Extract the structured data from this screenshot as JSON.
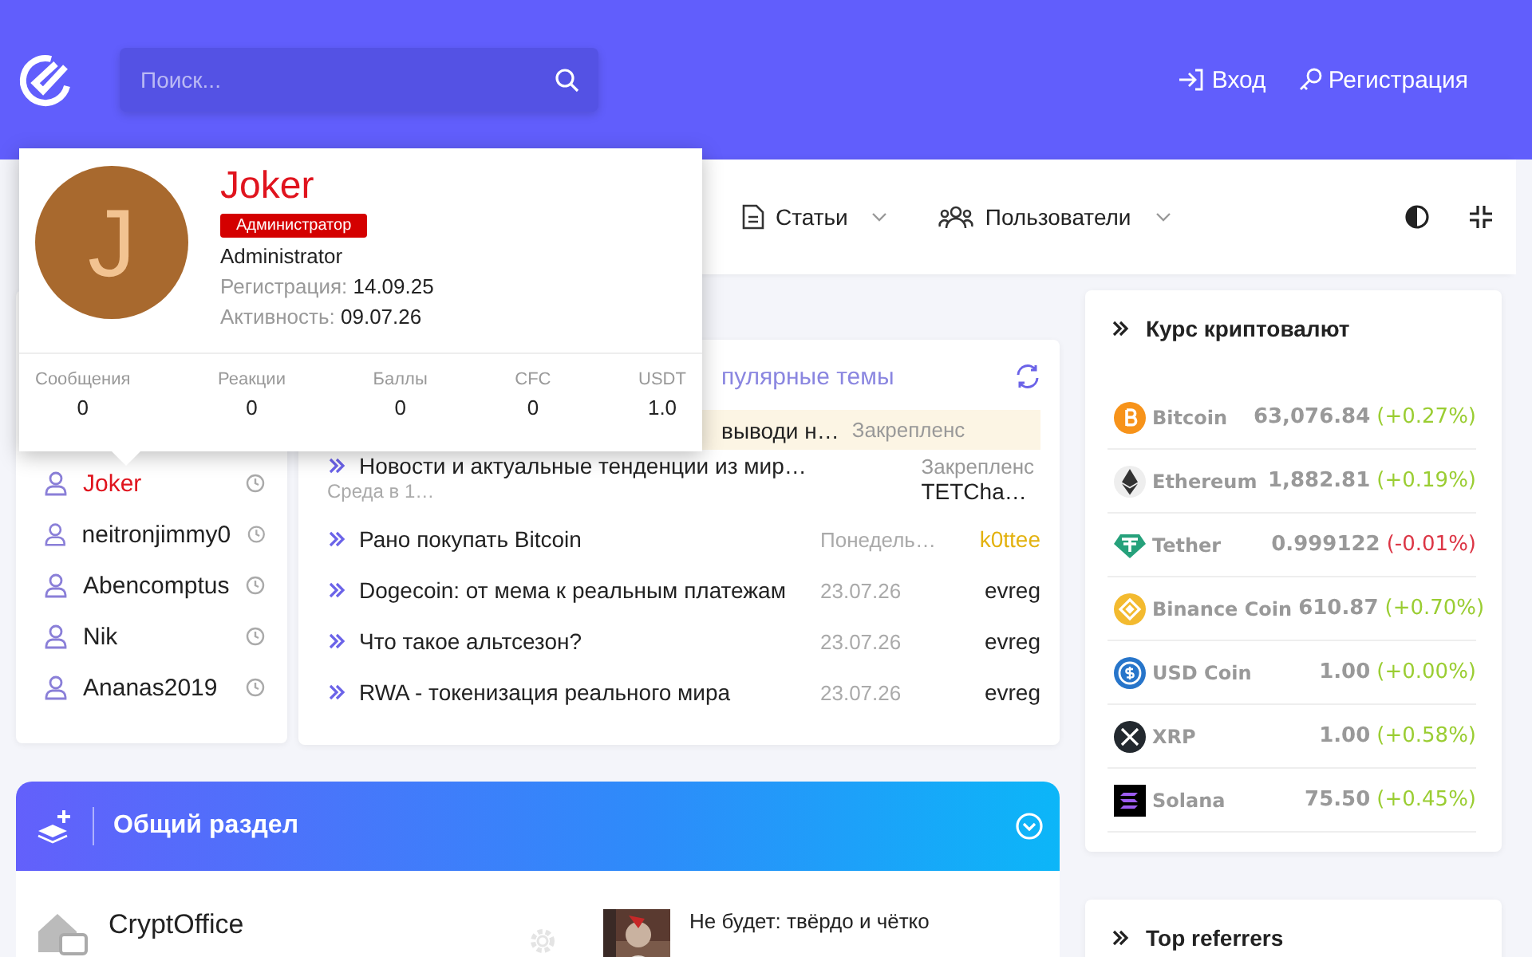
{
  "header": {
    "search": {
      "placeholder": "Поиск..."
    },
    "links": [
      "Вход",
      "Регистрация"
    ]
  },
  "nav": {
    "items": [
      "Статьи",
      "Пользователи"
    ]
  },
  "online_users": [
    {
      "name": "Joker",
      "kind": "admin"
    },
    {
      "name": "neitronjimmy0",
      "kind": "user"
    },
    {
      "name": "Abencomptus",
      "kind": "user"
    },
    {
      "name": "Nik",
      "kind": "user"
    },
    {
      "name": "Ananas2019",
      "kind": "user"
    }
  ],
  "popular_topics": {
    "title": "пулярные темы",
    "rows": [
      {
        "kind": "pinned",
        "title": "выводи н…",
        "tag": "Закрепленс"
      },
      {
        "kind": "wrapped",
        "title": "Новости и актуальные тенденции из мир…",
        "tag": "Закрепленс",
        "date": "Среда в 1…",
        "author": "TETCha…",
        "color": "#222222"
      },
      {
        "kind": "topic",
        "title": "Рано покупать Bitcoin",
        "date": "Понедель…",
        "author": "k0ttee",
        "color": "#e3b20f"
      },
      {
        "kind": "topic",
        "title": "Dogecoin: от мема к реальным платежам",
        "date": "23.07.26",
        "author": "evreg",
        "color": "#222222"
      },
      {
        "kind": "topic",
        "title": "Что такое альтсезон?",
        "date": "23.07.26",
        "author": "evreg",
        "color": "#222222"
      },
      {
        "kind": "topic",
        "title": "RWA - токенизация реального мира",
        "date": "23.07.26",
        "author": "evreg",
        "color": "#222222"
      }
    ]
  },
  "crypto": {
    "title": "Курс криптовалют",
    "coins": [
      {
        "name": "Bitcoin",
        "price": "63,076.84",
        "change": "(+0.27%)",
        "color": "#9acd32"
      },
      {
        "name": "Ethereum",
        "price": "1,882.81",
        "change": "(+0.19%)",
        "color": "#9acd32"
      },
      {
        "name": "Tether",
        "price": "0.999122",
        "change": "(-0.01%)",
        "color": "#dc3545"
      },
      {
        "name": "Binance Coin",
        "price": "610.87",
        "change": "(+0.70%)",
        "color": "#9acd32"
      },
      {
        "name": "USD Coin",
        "price": "1.00",
        "change": "(+0.00%)",
        "color": "#9acd32"
      },
      {
        "name": "XRP",
        "price": "1.00",
        "change": "(+0.58%)",
        "color": "#9acd32"
      },
      {
        "name": "Solana",
        "price": "75.50",
        "change": "(+0.45%)",
        "color": "#9acd32"
      }
    ]
  },
  "top_referrers": {
    "title": "Top referrers"
  },
  "section": {
    "title": "Общий раздел",
    "expanded": true,
    "forum": {
      "name": "CryptOffice",
      "last_post": "Не будет: твёрдо и чётко"
    }
  },
  "profile_popup": {
    "avatar_letter": "J",
    "name": "Joker",
    "badge": "Администратор",
    "title": "Administrator",
    "registered_label": "Регистрация:",
    "registered": "14.09.25",
    "active_label": "Активность:",
    "active": "09.07.26",
    "stats": [
      {
        "label": "Сообщения",
        "value": "0"
      },
      {
        "label": "Реакции",
        "value": "0"
      },
      {
        "label": "Баллы",
        "value": "0"
      },
      {
        "label": "CFC",
        "value": "0"
      },
      {
        "label": "USDT",
        "value": "1.0"
      }
    ]
  }
}
